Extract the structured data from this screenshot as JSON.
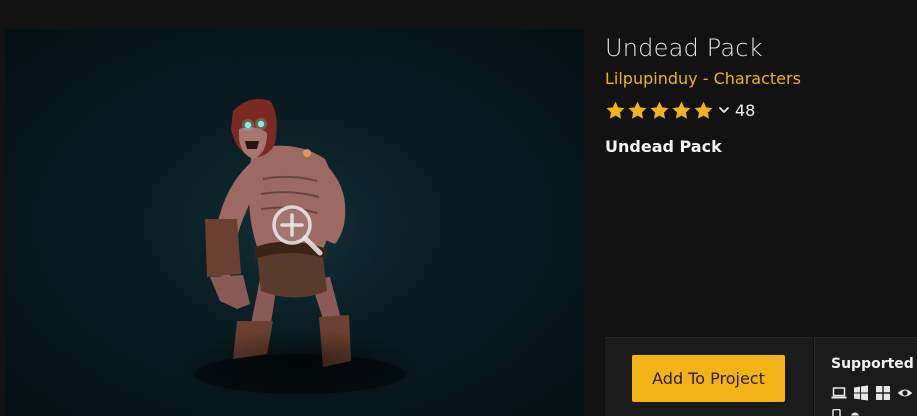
{
  "product": {
    "title": "Undead Pack",
    "author": "Lilpupinduy",
    "separator": "-",
    "category": "Characters",
    "rating_count": "48",
    "rating_stars": 5,
    "description": "Undead Pack"
  },
  "actions": {
    "add_to_project_label": "Add To Project"
  },
  "platforms": {
    "label": "Supported Platforms",
    "icons": [
      "laptop-icon",
      "windows-icon",
      "windows-icon",
      "eye-icon"
    ]
  },
  "colors": {
    "accent": "#f1b318",
    "link": "#f0b31d",
    "background": "#121212",
    "panel": "#1b1b1b"
  }
}
